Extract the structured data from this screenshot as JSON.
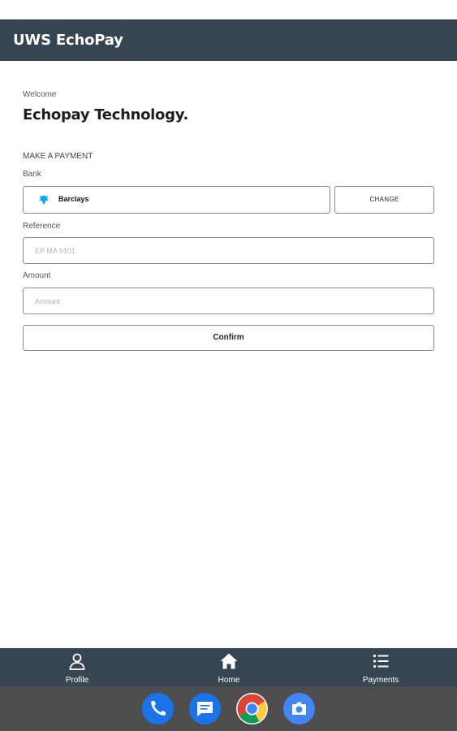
{
  "app": {
    "title": "UWS EchoPay"
  },
  "main": {
    "welcome": "Welcome",
    "company": "Echopay Technology.",
    "section_title": "MAKE A PAYMENT",
    "bank": {
      "label": "Bank",
      "name": "Barclays",
      "change_label": "CHANGE"
    },
    "reference": {
      "label": "Reference",
      "value": "",
      "placeholder": "EP MA 9101"
    },
    "amount": {
      "label": "Amount",
      "value": "",
      "placeholder": "Amount"
    },
    "confirm_label": "Confirm"
  },
  "nav": {
    "items": [
      {
        "label": "Profile",
        "icon": "person-icon"
      },
      {
        "label": "Home",
        "icon": "home-icon"
      },
      {
        "label": "Payments",
        "icon": "list-icon"
      }
    ]
  },
  "dock": {
    "icons": [
      "phone-icon",
      "messages-icon",
      "chrome-icon",
      "camera-icon"
    ]
  },
  "colors": {
    "app_bar": "#374552",
    "system_bar": "#4d4d4d",
    "barclays_blue": "#00AEEF"
  }
}
